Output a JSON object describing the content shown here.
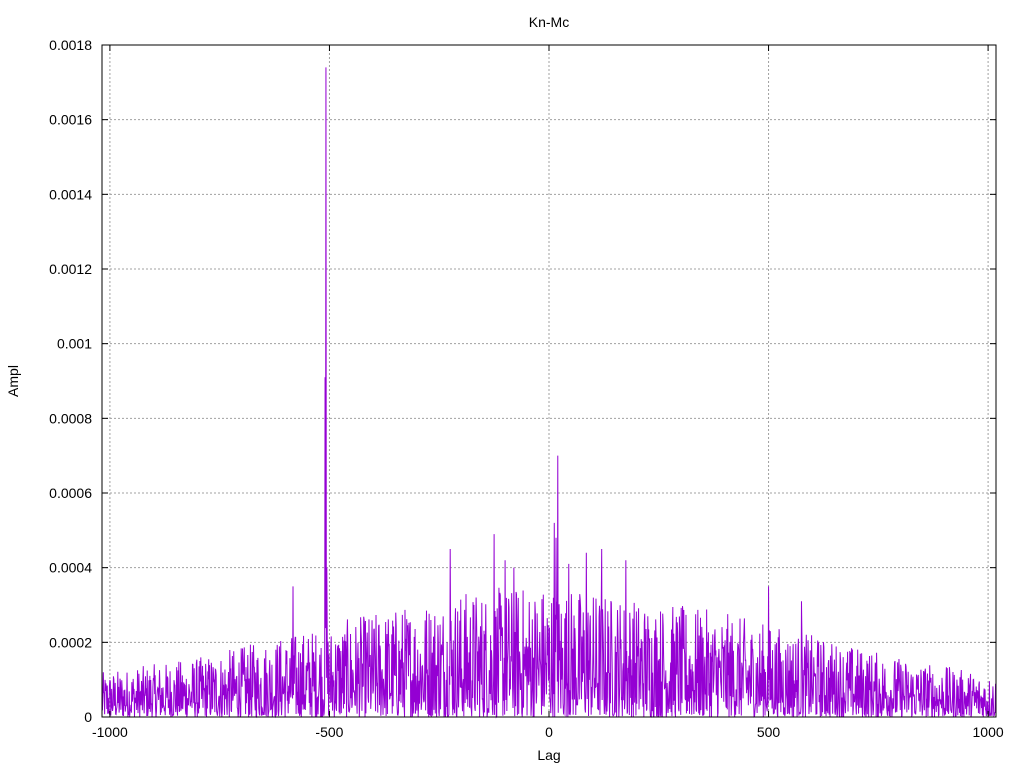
{
  "chart_data": {
    "type": "line",
    "title": "Kn-Mc",
    "xlabel": "Lag",
    "ylabel": "Ampl",
    "xlim": [
      -1018,
      1018
    ],
    "ylim": [
      0,
      0.0018
    ],
    "xticks": [
      -1000,
      -500,
      0,
      500,
      1000
    ],
    "xtick_labels": [
      "-1000",
      "-500",
      "0",
      "500",
      "1000"
    ],
    "yticks": [
      0,
      0.0002,
      0.0004,
      0.0006,
      0.0008,
      0.001,
      0.0012,
      0.0014,
      0.0016,
      0.0018
    ],
    "ytick_labels": [
      "0",
      "0.0002",
      "0.0004",
      "0.0006",
      "0.0008",
      "0.001",
      "0.0012",
      "0.0014",
      "0.0016",
      "0.0018"
    ],
    "grid": true,
    "legend": "none",
    "series_color": "#9400d3",
    "lag_step": 1,
    "noise_envelope": {
      "lag": [
        -1018,
        -800,
        -600,
        -400,
        -200,
        0,
        200,
        400,
        600,
        800,
        1018
      ],
      "max": [
        0.00012,
        0.00016,
        0.00022,
        0.00028,
        0.00034,
        0.00036,
        0.00032,
        0.00028,
        0.00022,
        0.00016,
        0.00011
      ]
    },
    "peaks": [
      {
        "lag": -508,
        "value": 0.00174
      },
      {
        "lag": -510,
        "value": 0.00091
      },
      {
        "lag": -506,
        "value": 0.0004
      },
      {
        "lag": -583,
        "value": 0.00035
      },
      {
        "lag": -125,
        "value": 0.00049
      },
      {
        "lag": -225,
        "value": 0.00045
      },
      {
        "lag": -100,
        "value": 0.00042
      },
      {
        "lag": -80,
        "value": 0.0004
      },
      {
        "lag": 20,
        "value": 0.0007
      },
      {
        "lag": 12,
        "value": 0.00052
      },
      {
        "lag": 16,
        "value": 0.00048
      },
      {
        "lag": 45,
        "value": 0.00041
      },
      {
        "lag": 85,
        "value": 0.00044
      },
      {
        "lag": 120,
        "value": 0.00045
      },
      {
        "lag": 175,
        "value": 0.00042
      },
      {
        "lag": 500,
        "value": 0.00035
      },
      {
        "lag": 575,
        "value": 0.00031
      }
    ]
  }
}
